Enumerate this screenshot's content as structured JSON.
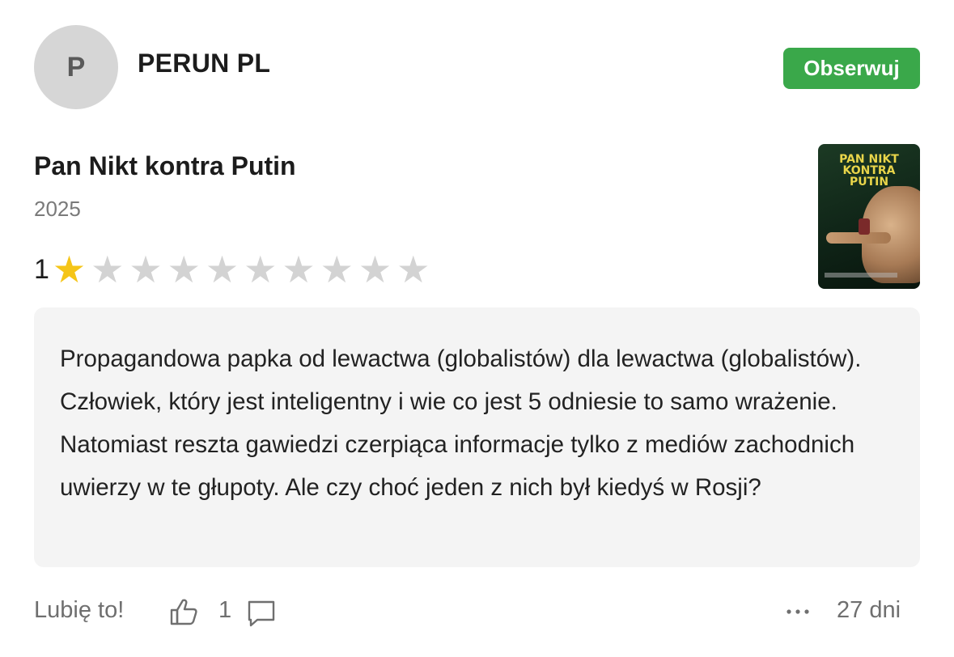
{
  "user": {
    "avatar_initial": "P",
    "name": "PERUN PL",
    "follow_label": "Obserwuj"
  },
  "movie": {
    "title": "Pan Nikt kontra Putin",
    "year": "2025",
    "poster_title_lines": [
      "PAN NIKT",
      "KONTRA",
      "PUTIN"
    ]
  },
  "rating": {
    "value": "1",
    "max_stars": 10,
    "filled_stars": 1
  },
  "review": {
    "text": "Propagandowa papka od lewactwa (globalistów) dla lewactwa (globalistów). Człowiek, który jest inteligentny i wie co jest 5 odniesie to samo wrażenie. Natomiast reszta gawiedzi czerpiąca informacje tylko z mediów zachodnich uwierzy w te głupoty. Ale czy choć jeden z nich był kiedyś w Rosji?"
  },
  "footer": {
    "like_label": "Lubię to!",
    "like_count": "1",
    "age": "27 dni"
  },
  "icons": {
    "like": "thumbs-up-icon",
    "comment": "comment-icon",
    "more": "more-dots-icon"
  },
  "colors": {
    "follow_button": "#3aa84a",
    "star_on": "#f5c518",
    "star_off": "#d3d3d3",
    "review_bg": "#f4f4f4"
  }
}
